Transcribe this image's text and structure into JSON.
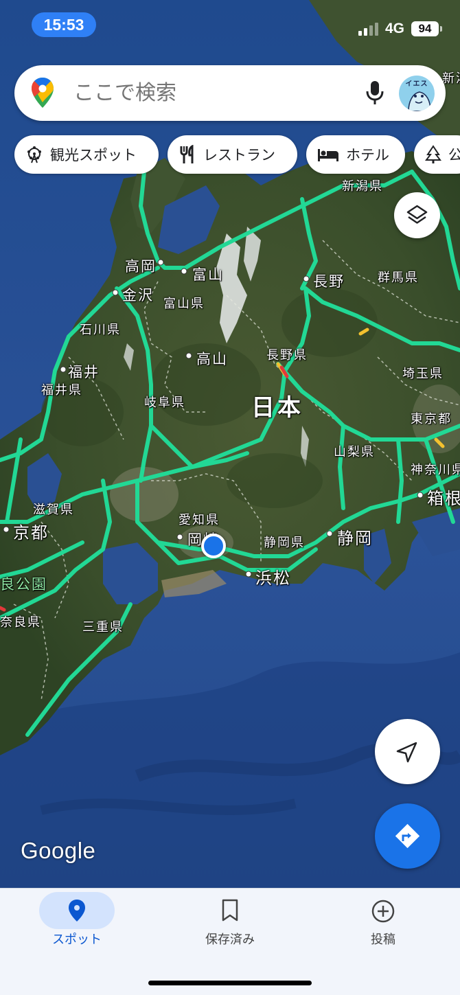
{
  "status_bar": {
    "time": "15:53",
    "network": "4G",
    "battery": "94"
  },
  "search": {
    "placeholder": "ここで検索"
  },
  "avatar": {
    "text": "イエス"
  },
  "chips": [
    {
      "label": "観光スポット",
      "icon": "ferris-wheel-icon"
    },
    {
      "label": "レストラン",
      "icon": "fork-knife-icon"
    },
    {
      "label": "ホテル",
      "icon": "bed-icon"
    },
    {
      "label": "公",
      "icon": "tree-icon"
    }
  ],
  "map": {
    "labels": {
      "niigata_pref": "新潟県",
      "niigata_city_partial": "新潟",
      "takaoka": "高岡",
      "toyama": "富山",
      "nagano": "長野",
      "gunma_pref": "群馬県",
      "kanazawa": "金沢",
      "toyama_pref": "富山県",
      "ishikawa_pref": "石川県",
      "takayama": "高山",
      "nagano_pref": "長野県",
      "fukui": "福井",
      "fukui_pref": "福井県",
      "saitama_pref": "埼玉県",
      "gifu_pref": "岐阜県",
      "japan": "日本",
      "tokyo": "東京都",
      "yamanashi_pref": "山梨県",
      "kanagawa_pref": "神奈川県",
      "hakone": "箱根",
      "shiga_pref": "滋賀県",
      "aichi_pref": "愛知県",
      "kyoto": "京都",
      "okazaki": "岡崎",
      "shizuoka_pref": "静岡県",
      "shizuoka": "静岡",
      "hamamatsu": "浜松",
      "nara_park": "良公園",
      "nara_pref": "奈良県",
      "mie_pref": "三重県"
    },
    "colors": {
      "highway": "#22d895",
      "sea": "#2a4d8f",
      "land": "#3c4f2a"
    }
  },
  "branding": {
    "logo": "Google"
  },
  "bottom_nav": [
    {
      "label": "スポット",
      "icon": "location-pin-icon",
      "active": true
    },
    {
      "label": "保存済み",
      "icon": "bookmark-icon",
      "active": false
    },
    {
      "label": "投稿",
      "icon": "add-circle-icon",
      "active": false
    }
  ]
}
